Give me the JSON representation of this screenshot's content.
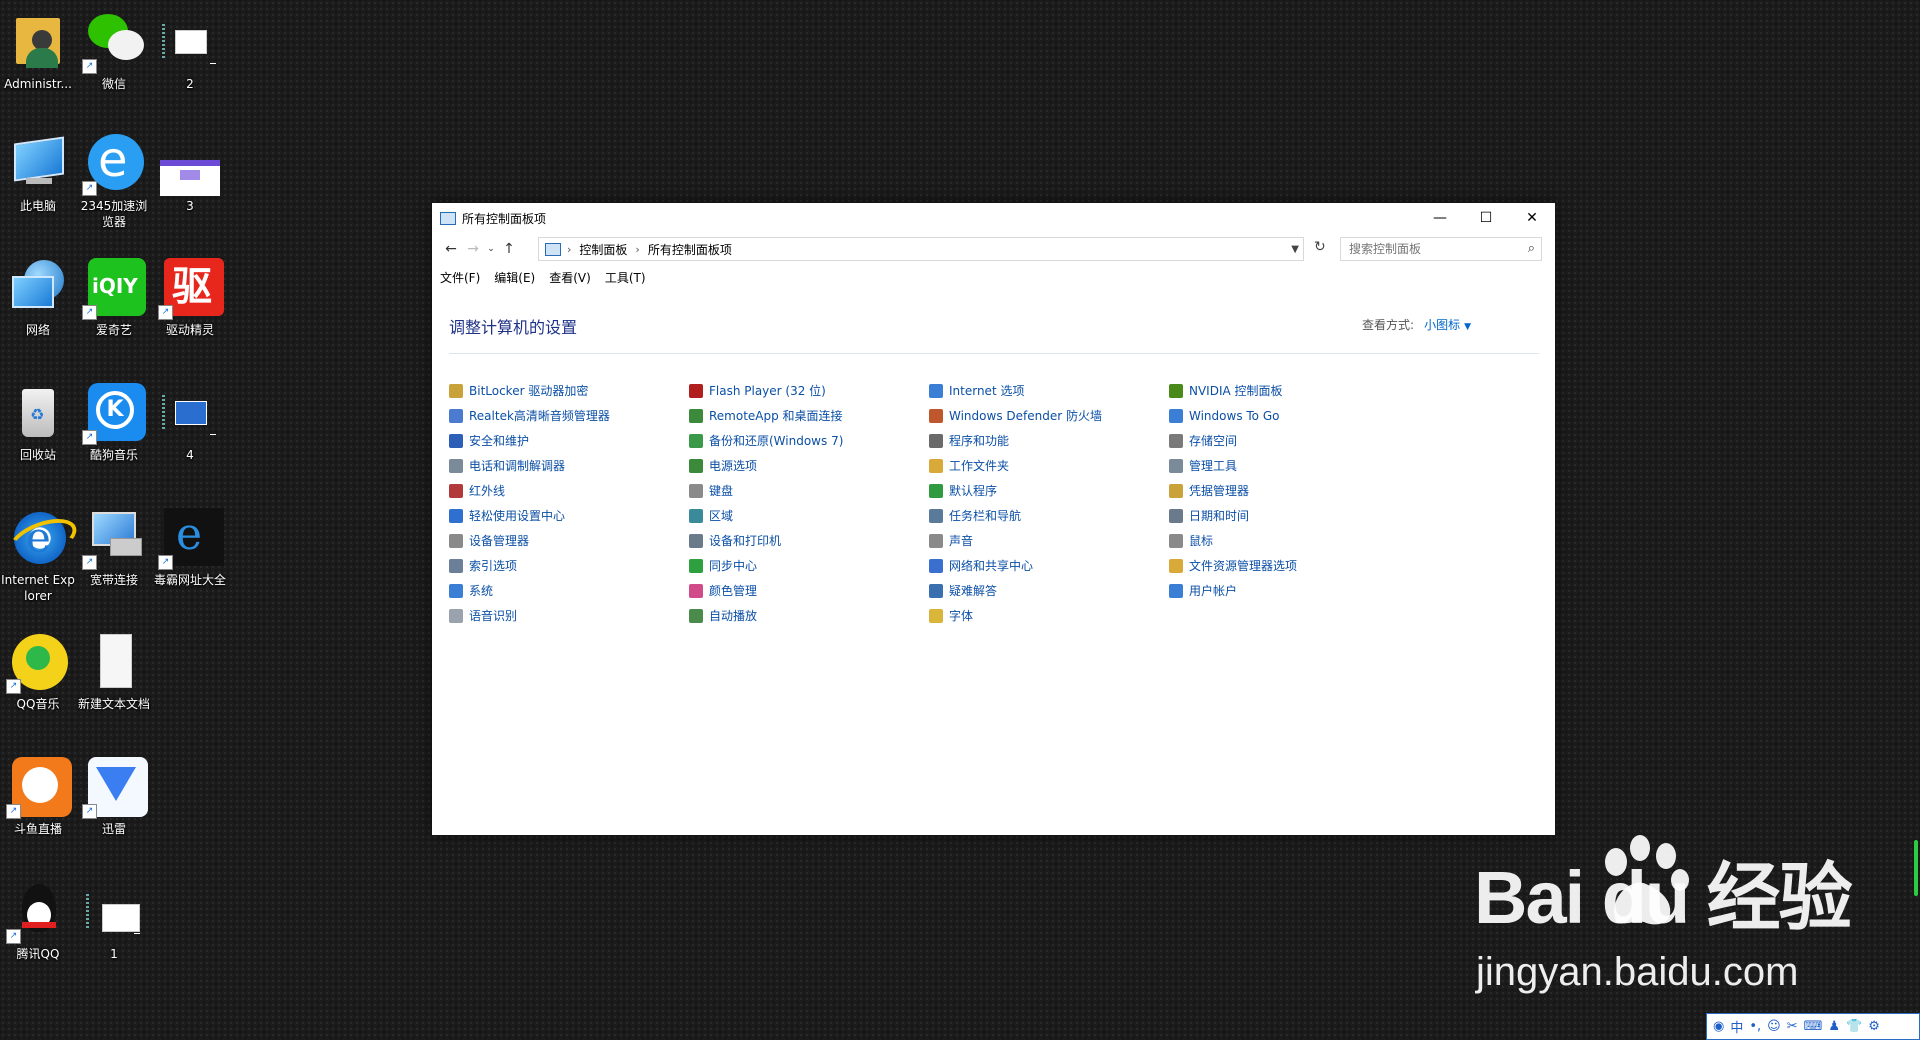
{
  "desktop": {
    "icons": [
      {
        "label": "Administr...",
        "icon": "user-folder-icon"
      },
      {
        "label": "微信",
        "icon": "wechat-icon"
      },
      {
        "label": "2",
        "icon": "file-icon"
      },
      {
        "label": "此电脑",
        "icon": "computer-icon"
      },
      {
        "label": "2345加速浏览器",
        "icon": "browser-2345-icon"
      },
      {
        "label": "3",
        "icon": "screenshot-file-icon"
      },
      {
        "label": "网络",
        "icon": "network-icon"
      },
      {
        "label": "爱奇艺",
        "icon": "iqiyi-icon"
      },
      {
        "label": "驱动精灵",
        "icon": "driver-genius-icon"
      },
      {
        "label": "回收站",
        "icon": "recycle-bin-icon"
      },
      {
        "label": "酷狗音乐",
        "icon": "kugou-icon"
      },
      {
        "label": "4",
        "icon": "file-icon"
      },
      {
        "label": "Internet Explorer",
        "icon": "ie-icon"
      },
      {
        "label": "宽带连接",
        "icon": "broadband-icon"
      },
      {
        "label": "毒霸网址大全",
        "icon": "ie-icon"
      },
      {
        "label": "QQ音乐",
        "icon": "qqmusic-icon"
      },
      {
        "label": "新建文本文档",
        "icon": "text-file-icon"
      },
      {
        "label": "斗鱼直播",
        "icon": "douyu-icon"
      },
      {
        "label": "迅雷",
        "icon": "xunlei-icon"
      },
      {
        "label": "腾讯QQ",
        "icon": "qq-icon"
      },
      {
        "label": "1",
        "icon": "file-icon"
      }
    ]
  },
  "window": {
    "title": "所有控制面板项",
    "controls": {
      "minimize": "—",
      "maximize": "☐",
      "close": "✕"
    },
    "address": {
      "crumbs": [
        "控制面板",
        "所有控制面板项"
      ]
    },
    "search": {
      "placeholder": "搜索控制面板"
    },
    "menu": [
      "文件(F)",
      "编辑(E)",
      "查看(V)",
      "工具(T)"
    ],
    "heading": "调整计算机的设置",
    "view_by": {
      "label": "查看方式:",
      "value": "小图标"
    },
    "items": [
      {
        "label": "BitLocker 驱动器加密",
        "color": "#c9a23a"
      },
      {
        "label": "Realtek高清晰音频管理器",
        "color": "#4b7bd1"
      },
      {
        "label": "安全和维护",
        "color": "#2d5fb8"
      },
      {
        "label": "电话和调制解调器",
        "color": "#7a8a99"
      },
      {
        "label": "红外线",
        "color": "#b33a3a"
      },
      {
        "label": "轻松使用设置中心",
        "color": "#2f6fd0"
      },
      {
        "label": "设备管理器",
        "color": "#8a8a8a"
      },
      {
        "label": "索引选项",
        "color": "#6b7f99"
      },
      {
        "label": "系统",
        "color": "#3a7ed6"
      },
      {
        "label": "语音识别",
        "color": "#9aa3ad"
      },
      {
        "label": "Flash Player (32 位)",
        "color": "#b01e1e"
      },
      {
        "label": "RemoteApp 和桌面连接",
        "color": "#3b8a3b"
      },
      {
        "label": "备份和还原(Windows 7)",
        "color": "#3b9a4a"
      },
      {
        "label": "电源选项",
        "color": "#3a8a3a"
      },
      {
        "label": "键盘",
        "color": "#8a8a8a"
      },
      {
        "label": "区域",
        "color": "#3a8a9a"
      },
      {
        "label": "设备和打印机",
        "color": "#6b7a88"
      },
      {
        "label": "同步中心",
        "color": "#2fa03f"
      },
      {
        "label": "颜色管理",
        "color": "#d14a8a"
      },
      {
        "label": "自动播放",
        "color": "#4a8a4a"
      },
      {
        "label": "Internet 选项",
        "color": "#3a7ed6"
      },
      {
        "label": "Windows Defender 防火墙",
        "color": "#c0562b"
      },
      {
        "label": "程序和功能",
        "color": "#6a6a6a"
      },
      {
        "label": "工作文件夹",
        "color": "#d9a93a"
      },
      {
        "label": "默认程序",
        "color": "#2f9a3f"
      },
      {
        "label": "任务栏和导航",
        "color": "#5a7a99"
      },
      {
        "label": "声音",
        "color": "#8a8a8a"
      },
      {
        "label": "网络和共享中心",
        "color": "#3a6fd0"
      },
      {
        "label": "疑难解答",
        "color": "#3a6fb0"
      },
      {
        "label": "字体",
        "color": "#d9b53a"
      },
      {
        "label": "NVIDIA 控制面板",
        "color": "#4a8a1a"
      },
      {
        "label": "Windows To Go",
        "color": "#3a7ed6"
      },
      {
        "label": "存储空间",
        "color": "#7a7a7a"
      },
      {
        "label": "管理工具",
        "color": "#7a8a99"
      },
      {
        "label": "凭据管理器",
        "color": "#c9a23a"
      },
      {
        "label": "日期和时间",
        "color": "#6a7a8a"
      },
      {
        "label": "鼠标",
        "color": "#8a8a8a"
      },
      {
        "label": "文件资源管理器选项",
        "color": "#d9a93a"
      },
      {
        "label": "用户帐户",
        "color": "#3a7ed6"
      }
    ]
  },
  "watermark": {
    "brand": "Bai du 经验",
    "url": "jingyan.baidu.com"
  },
  "tray": {
    "ime": "中"
  }
}
